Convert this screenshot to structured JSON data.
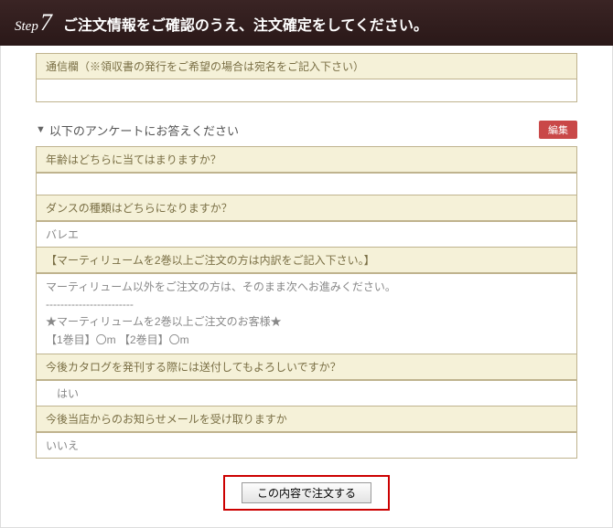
{
  "header": {
    "step_label": "Step",
    "step_number": "7",
    "title": "ご注文情報をご確認のうえ、注文確定をしてください。"
  },
  "message_field": {
    "label": "通信欄（※領収書の発行をご希望の場合は宛名をご記入下さい）",
    "value": ""
  },
  "survey": {
    "header_marker": "▼",
    "header_text": "以下のアンケートにお答えください",
    "edit_label": "編集",
    "rows": [
      {
        "type": "q",
        "text": "年齢はどちらに当てはまりますか？"
      },
      {
        "type": "a",
        "text": ""
      },
      {
        "type": "q",
        "text": "ダンスの種類はどちらになりますか？"
      },
      {
        "type": "a",
        "text": "バレエ"
      },
      {
        "type": "q",
        "text": "【マーティリュームを2巻以上ご注文の方は内訳をご記入下さい。】"
      },
      {
        "type": "a_multi",
        "text": "マーティリューム以外をご注文の方は、そのまま次へお進みください。\n------------------------\n★マーティリュームを2巻以上ご注文のお客様★\n【1巻目】〇m 【2巻目】〇m"
      },
      {
        "type": "q",
        "text": "今後カタログを発刊する際には送付してもよろしいですか？"
      },
      {
        "type": "a",
        "text": "　はい"
      },
      {
        "type": "q",
        "text": "今後当店からのお知らせメールを受け取りますか"
      },
      {
        "type": "a",
        "text": "いいえ"
      }
    ]
  },
  "submit": {
    "label": "この内容で注文する"
  }
}
